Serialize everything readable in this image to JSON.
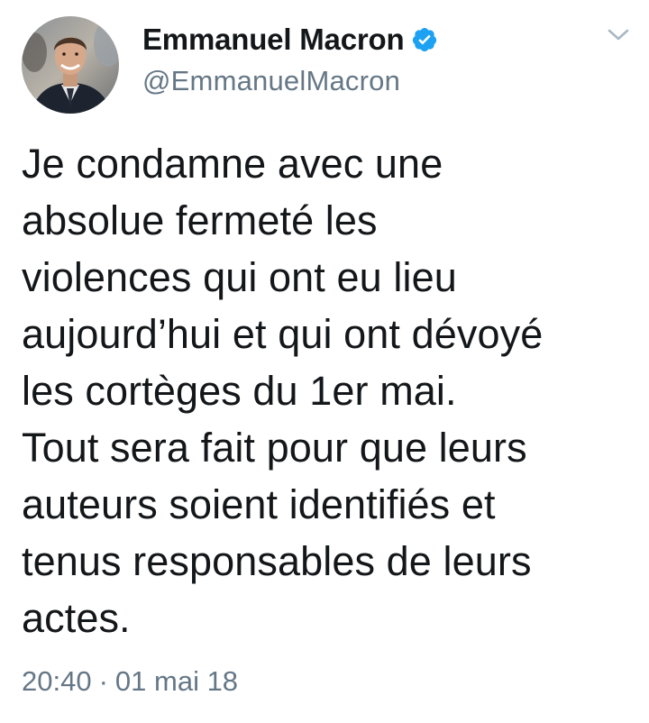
{
  "author": {
    "display_name": "Emmanuel Macron",
    "handle": "@EmmanuelMacron",
    "verified": true
  },
  "icons": {
    "verified": "verified-badge-icon",
    "menu": "chevron-down-icon"
  },
  "colors": {
    "text": "#14171a",
    "secondary": "#657786",
    "verified_blue": "#1da1f2",
    "background": "#ffffff"
  },
  "tweet": {
    "text": "Je condamne avec une\nabsolue fermeté les\nviolences qui ont eu lieu\naujourd’hui et qui ont dévoyé\nles cortèges du 1er mai.\nTout sera fait pour que leurs\nauteurs soient identifiés et\ntenus responsables de leurs\nactes.",
    "time": "20:40",
    "separator": "·",
    "date": "01 mai 18"
  }
}
